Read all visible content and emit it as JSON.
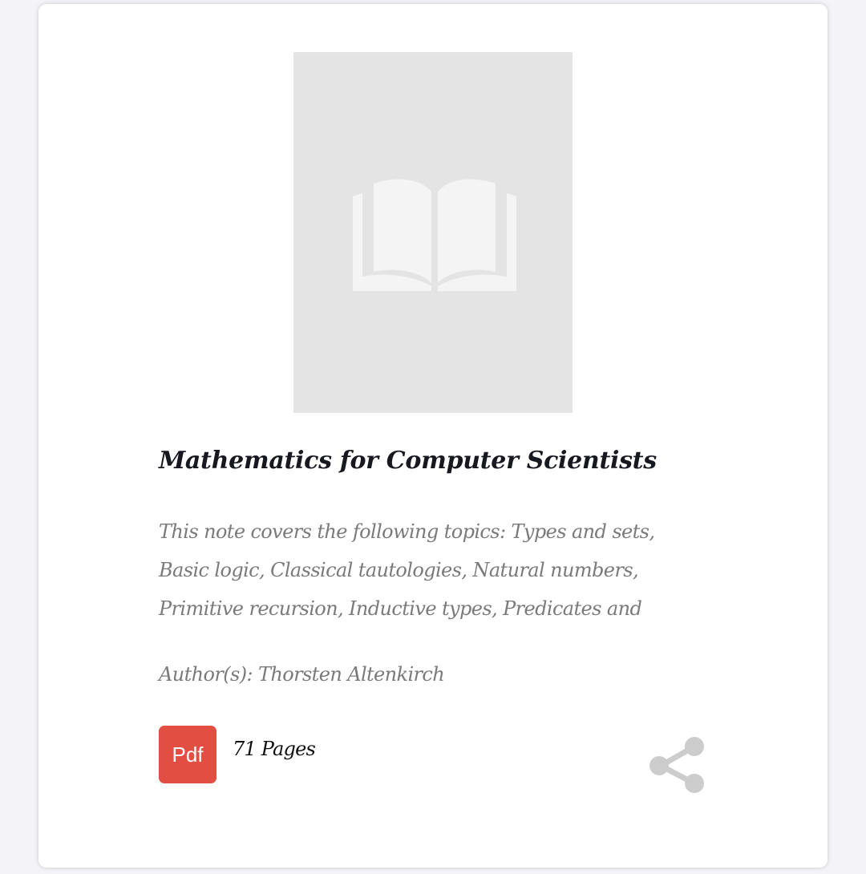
{
  "book": {
    "title": "Mathematics for Computer Scientists",
    "description_lines": [
      "This note covers the following topics: Types and sets,",
      "Basic logic, Classical tautologies, Natural numbers,",
      "Primitive recursion, Inductive types, Predicates and"
    ],
    "author": "Author(s): Thorsten Altenkirch",
    "file_type_label": "Pdf",
    "pages": "71 Pages",
    "cover_icon": "open-book-icon"
  },
  "actions": {
    "share_icon": "share-icon"
  },
  "colors": {
    "pdf_badge": "#e34e42",
    "cover_bg": "#e4e4e4",
    "muted_text": "#7a7a7a",
    "share_icon": "#cccccc"
  }
}
